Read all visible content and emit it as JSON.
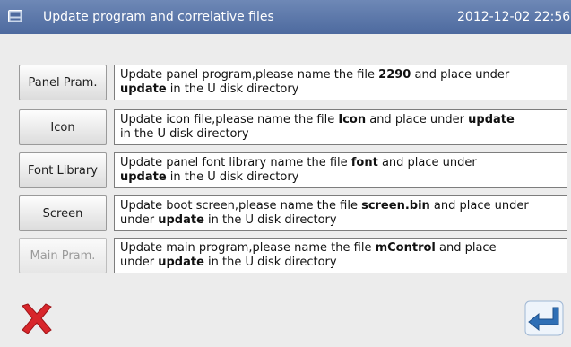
{
  "header": {
    "title": "Update program and correlative files",
    "datetime": "2012-12-02  22:56"
  },
  "rows": [
    {
      "button": "Panel Pram.",
      "enabled": true,
      "desc_parts": [
        "Update panel program,please name the file ",
        "2290",
        " and place under ",
        "update",
        " in the U disk directory"
      ]
    },
    {
      "button": "Icon",
      "enabled": true,
      "desc_parts": [
        "Update icon file,please name the file ",
        "Icon",
        " and place under ",
        "update",
        " in the U disk directory"
      ]
    },
    {
      "button": "Font Library",
      "enabled": true,
      "desc_parts": [
        "Update panel font library name the file ",
        "font",
        " and place under ",
        "update",
        " in the U disk directory"
      ]
    },
    {
      "button": "Screen",
      "enabled": true,
      "desc_parts": [
        "Update boot screen,please name the file ",
        "screen.bin",
        " and place under ",
        "update",
        " in the U disk directory"
      ]
    },
    {
      "button": "Main Pram.",
      "enabled": false,
      "desc_parts": [
        "Update main program,please name the file ",
        "mControl",
        " and place under ",
        "update",
        " in the U disk directory"
      ]
    }
  ],
  "footer": {
    "cancel_icon": "red-x-cancel-icon",
    "enter_icon": "blue-enter-return-icon"
  },
  "colors": {
    "titlebar": "#5a76a8",
    "background": "#ececec",
    "cancel_red": "#d8262b",
    "enter_blue": "#2f6fb5"
  }
}
